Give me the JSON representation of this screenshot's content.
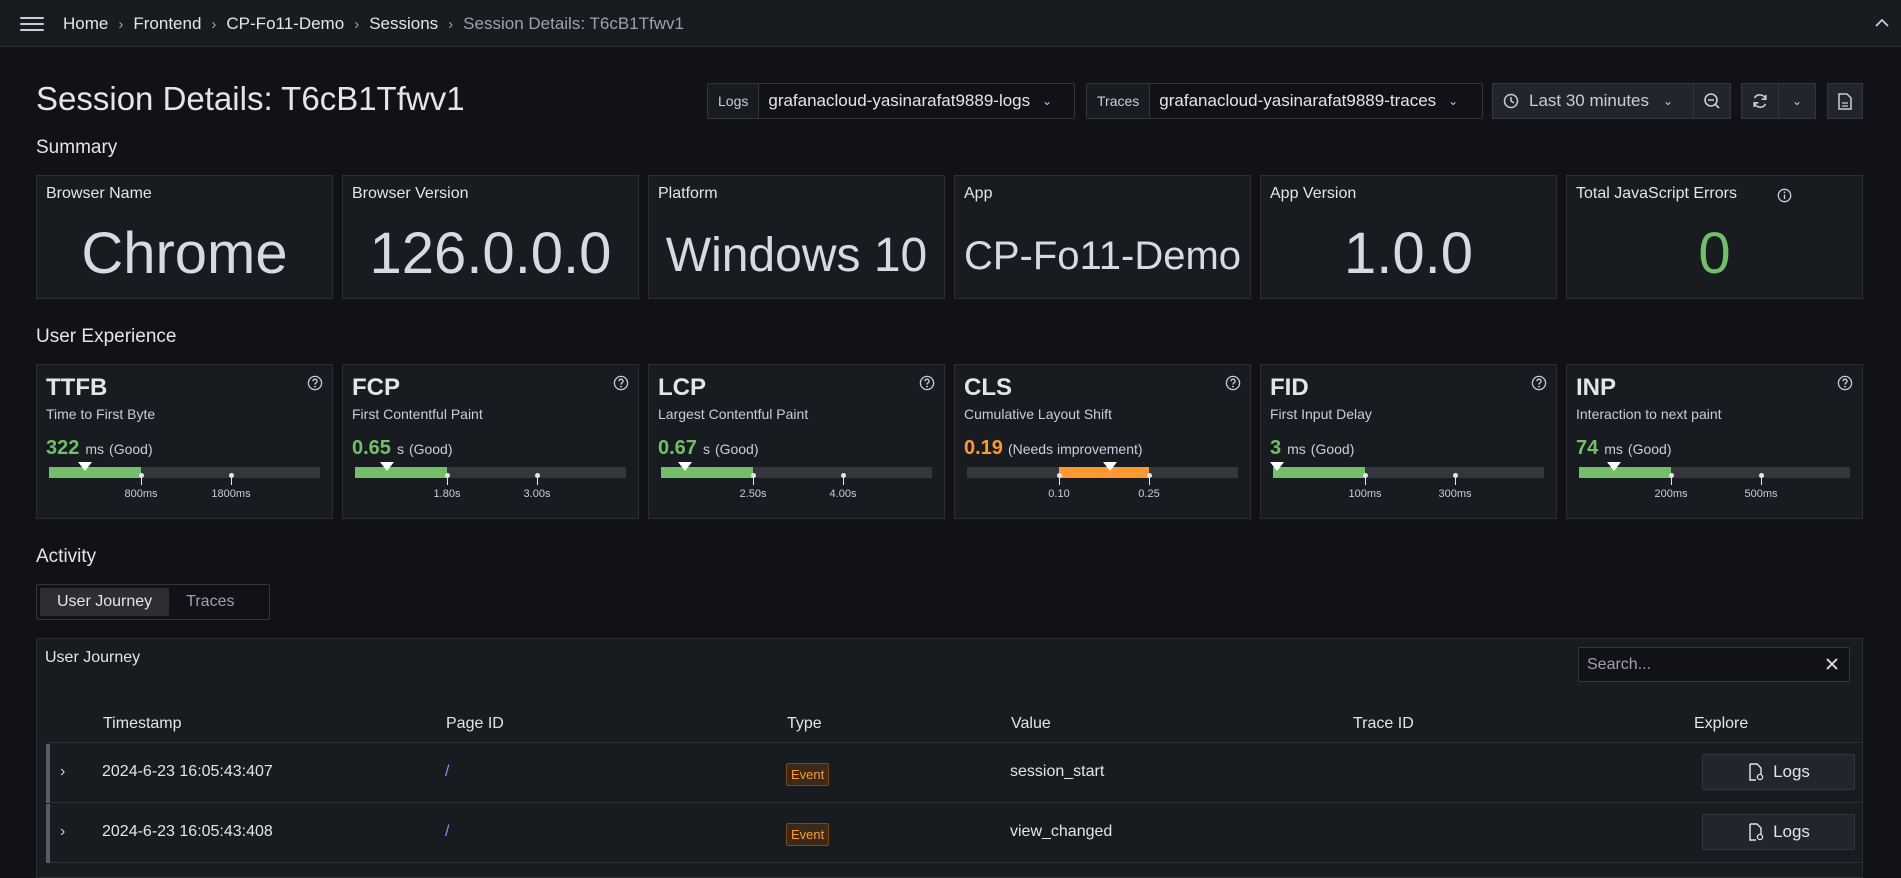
{
  "breadcrumb": [
    "Home",
    "Frontend",
    "CP-Fo11-Demo",
    "Sessions",
    "Session Details: T6cB1Tfwv1"
  ],
  "page_title": "Session Details: T6cB1Tfwv1",
  "pickers": {
    "logs": {
      "label": "Logs",
      "value": "grafanacloud-yasinarafat9889-logs"
    },
    "traces": {
      "label": "Traces",
      "value": "grafanacloud-yasinarafat9889-traces"
    }
  },
  "time_range": "Last 30 minutes",
  "summary": {
    "title": "Summary",
    "stats": [
      {
        "title": "Browser Name",
        "value": "Chrome"
      },
      {
        "title": "Browser Version",
        "value": "126.0.0.0"
      },
      {
        "title": "Platform",
        "value": "Windows 10"
      },
      {
        "title": "App",
        "value": "CP-Fo11-Demo"
      },
      {
        "title": "App Version",
        "value": "1.0.0"
      },
      {
        "title": "Total JavaScript Errors",
        "value": "0"
      }
    ]
  },
  "ux": {
    "title": "User Experience",
    "vitals": [
      {
        "abbr": "TTFB",
        "name": "Time to First Byte",
        "value": "322",
        "unit": "ms",
        "rating": "(Good)",
        "thresholds": [
          "800ms",
          "1800ms"
        ]
      },
      {
        "abbr": "FCP",
        "name": "First Contentful Paint",
        "value": "0.65",
        "unit": "s",
        "rating": "(Good)",
        "thresholds": [
          "1.80s",
          "3.00s"
        ]
      },
      {
        "abbr": "LCP",
        "name": "Largest Contentful Paint",
        "value": "0.67",
        "unit": "s",
        "rating": "(Good)",
        "thresholds": [
          "2.50s",
          "4.00s"
        ]
      },
      {
        "abbr": "CLS",
        "name": "Cumulative Layout Shift",
        "value": "0.19",
        "unit": "",
        "rating": "(Needs improvement)",
        "thresholds": [
          "0.10",
          "0.25"
        ]
      },
      {
        "abbr": "FID",
        "name": "First Input Delay",
        "value": "3",
        "unit": "ms",
        "rating": "(Good)",
        "thresholds": [
          "100ms",
          "300ms"
        ]
      },
      {
        "abbr": "INP",
        "name": "Interaction to next paint",
        "value": "74",
        "unit": "ms",
        "rating": "(Good)",
        "thresholds": [
          "200ms",
          "500ms"
        ]
      }
    ]
  },
  "activity": {
    "title": "Activity",
    "tabs": [
      "User Journey",
      "Traces"
    ],
    "active_tab": "User Journey"
  },
  "journey": {
    "title": "User Journey",
    "search_placeholder": "Search...",
    "columns": [
      "Timestamp",
      "Page ID",
      "Type",
      "Value",
      "Trace ID",
      "Explore"
    ],
    "rows": [
      {
        "timestamp": "2024-6-23 16:05:43:407",
        "page": "/",
        "type": "Event",
        "value": "session_start",
        "trace": "",
        "explore": "Logs"
      },
      {
        "timestamp": "2024-6-23 16:05:43:408",
        "page": "/",
        "type": "Event",
        "value": "view_changed",
        "trace": "",
        "explore": "Logs"
      }
    ]
  },
  "colors": {
    "good": "#73bf69",
    "needs_improvement": "#ff9830",
    "bg": "#111217",
    "panel": "#181b1f",
    "link": "#6e9fff"
  }
}
